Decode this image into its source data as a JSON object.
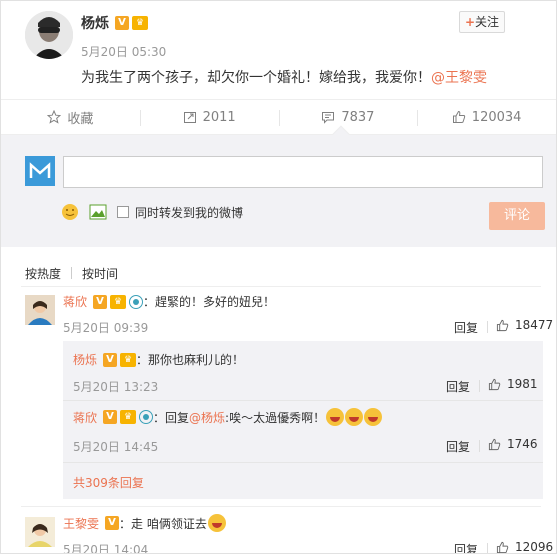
{
  "post": {
    "author": "杨烁",
    "time": "5月20日 05:30",
    "text": "为我生了两个孩子，却欠你一个婚礼！嫁给我，我爱你！",
    "mention": "@王黎雯",
    "follow_label": "关注"
  },
  "actions": {
    "favorite": "收藏",
    "repost": "2011",
    "comment": "7837",
    "like": "120034"
  },
  "composer": {
    "input_value": "",
    "sync_label": "同时转发到我的微博",
    "submit": "评论"
  },
  "sort": {
    "by_hot": "按热度",
    "by_time": "按时间"
  },
  "comments": [
    {
      "user": "蒋欣",
      "text": "：趕緊的！多好的妞兒！",
      "time": "5月20日 09:39",
      "reply": "回复",
      "likes": "18477",
      "replies": [
        {
          "user": "杨烁",
          "text": "：那你也麻利儿的！",
          "time": "5月20日 13:23",
          "reply": "回复",
          "likes": "1981"
        },
        {
          "user": "蒋欣",
          "prefix": "：回复",
          "mention": "@杨烁",
          "text": ":唉～太過優秀啊！",
          "time": "5月20日 14:45",
          "reply": "回复",
          "likes": "1746"
        }
      ],
      "more": "共309条回复"
    },
    {
      "user": "王黎雯",
      "text": "：走 咱俩领证去",
      "time": "5月20日 14:04",
      "reply": "回复",
      "likes": "12096"
    }
  ],
  "colors": {
    "accent": "#eb7350",
    "vip": "#f5a623",
    "submit": "#f7b99c"
  }
}
